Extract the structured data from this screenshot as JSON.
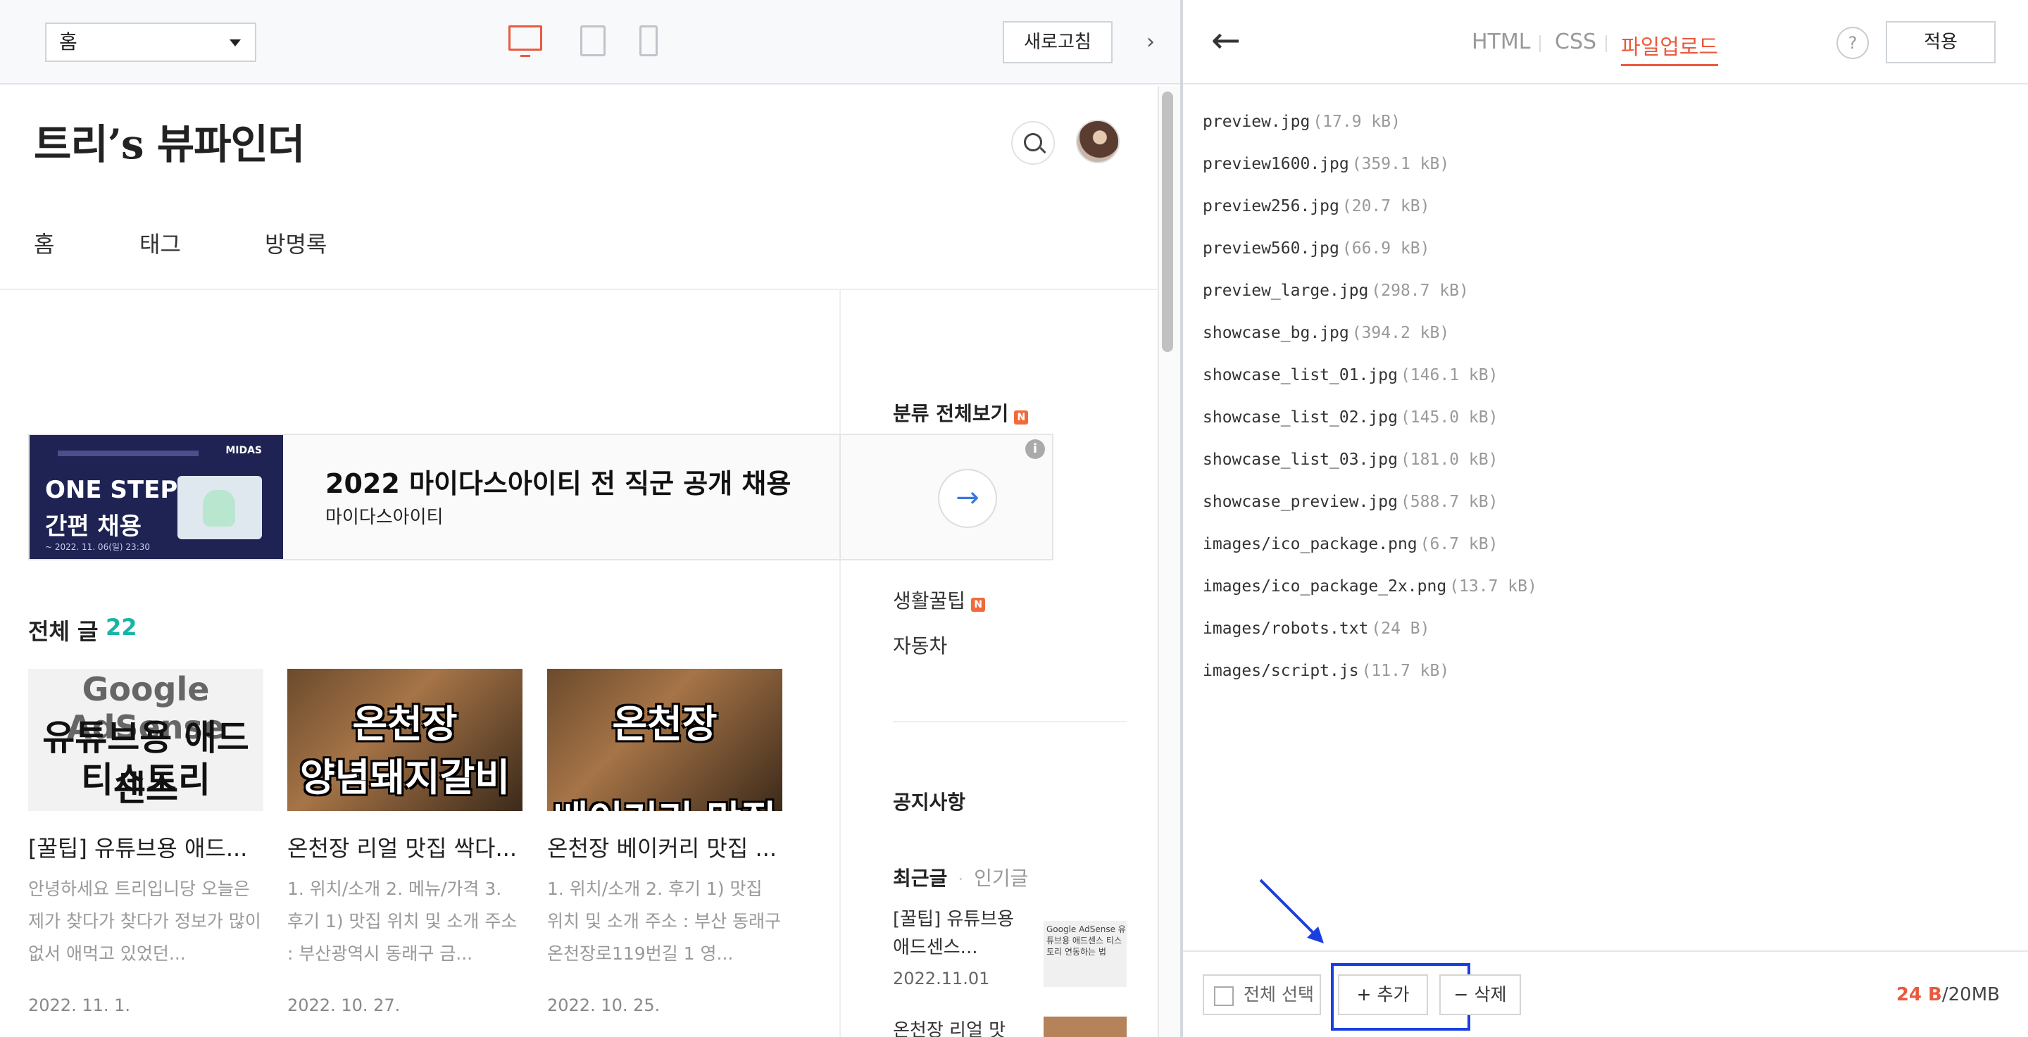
{
  "preview": {
    "page_select": "홈",
    "refresh_label": "새로고침",
    "collapse_glyph": "›",
    "blog_title": "트리’s 뷰파인더",
    "nav": {
      "home": "홈",
      "tag": "태그",
      "guestbook": "방명록"
    },
    "ad": {
      "thumb_line1": "ONE STEP",
      "thumb_line2": "간편 채용",
      "thumb_small": "~ 2022. 11. 06(일) 23:30",
      "thumb_logo": "MIDAS",
      "title": "2022 마이다스아이티 전 직군 공개 채용",
      "subtitle": "마이다스아이티",
      "arrow": "→",
      "info": "i"
    },
    "posts_heading": "전체 글",
    "posts_count": "22",
    "posts": [
      {
        "thumb_lines": [
          "Google AdSense",
          "유튜브용 애드센스",
          "티스토리"
        ],
        "title": "[꿀팁] 유튜브용 애드...",
        "excerpt": "안녕하세요 트리입니당 오늘은 제가 찾다가 찾다가 정보가 많이 없서 애먹고 있었던...",
        "date": "2022. 11. 1."
      },
      {
        "thumb_lines": [
          "온천장",
          "양념돼지갈비",
          ""
        ],
        "title": "온천장 리얼 맛집 싹다...",
        "excerpt": "1. 위치/소개 2. 메뉴/가격 3. 후기 1) 맛집 위치 및 소개 주소 : 부산광역시 동래구 금...",
        "date": "2022. 10. 27."
      },
      {
        "thumb_lines": [
          "온천장",
          "",
          "베이커리 맛집"
        ],
        "title": "온천장 베이커리 맛집 ...",
        "excerpt": "1. 위치/소개 2. 후기 1) 맛집 위치 및 소개 주소 : 부산 동래구 온천장로119번길 1 영...",
        "date": "2022. 10. 25."
      }
    ],
    "sidebar": {
      "categories_heading": "분류 전체보기",
      "badge": "N",
      "categories": [
        {
          "label": "생활꿀팁",
          "badge": "N"
        },
        {
          "label": "자동차",
          "badge": ""
        }
      ],
      "notice_heading": "공지사항",
      "tab_recent": "최근글",
      "tab_popular": "인기글",
      "recent_posts": [
        {
          "title_line1": "[꿀팁] 유튜브용",
          "title_line2": "애드센스...",
          "date": "2022.11.01",
          "thumb_text": "Google AdSense 유튜브용 애드센스 티스토리 연동하는 법"
        },
        {
          "title_line1": "온천장 리얼 맛",
          "title_line2": "",
          "date": "",
          "thumb_text": ""
        }
      ]
    }
  },
  "editor": {
    "back_glyph": "←",
    "tabs": {
      "html": "HTML",
      "css": "CSS",
      "files": "파일업로드"
    },
    "help": "?",
    "apply_label": "적용",
    "files": [
      {
        "name": "preview.jpg",
        "size": "(17.9 kB)"
      },
      {
        "name": "preview1600.jpg",
        "size": "(359.1 kB)"
      },
      {
        "name": "preview256.jpg",
        "size": "(20.7 kB)"
      },
      {
        "name": "preview560.jpg",
        "size": "(66.9 kB)"
      },
      {
        "name": "preview_large.jpg",
        "size": "(298.7 kB)"
      },
      {
        "name": "showcase_bg.jpg",
        "size": "(394.2 kB)"
      },
      {
        "name": "showcase_list_01.jpg",
        "size": "(146.1 kB)"
      },
      {
        "name": "showcase_list_02.jpg",
        "size": "(145.0 kB)"
      },
      {
        "name": "showcase_list_03.jpg",
        "size": "(181.0 kB)"
      },
      {
        "name": "showcase_preview.jpg",
        "size": "(588.7 kB)"
      },
      {
        "name": "images/ico_package.png",
        "size": "(6.7 kB)"
      },
      {
        "name": "images/ico_package_2x.png",
        "size": "(13.7 kB)"
      },
      {
        "name": "images/robots.txt",
        "size": "(24 B)"
      },
      {
        "name": "images/script.js",
        "size": "(11.7 kB)"
      }
    ],
    "footer": {
      "select_all": "전체 선택",
      "add_label": "+ 추가",
      "delete_label": "− 삭제",
      "storage_used": "24 B",
      "storage_total": "/20MB"
    }
  },
  "colors": {
    "accent": "#ea5a3e",
    "highlight": "#1a3fe0",
    "count": "#18b4a8"
  }
}
